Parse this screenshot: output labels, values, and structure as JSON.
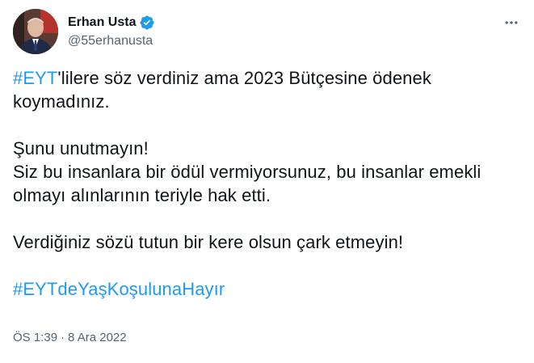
{
  "author": {
    "display_name": "Erhan Usta",
    "handle": "@55erhanusta",
    "verified_icon": "verified-badge-icon",
    "avatar": "profile-photo"
  },
  "menu_icon": "more-horizontal-icon",
  "tweet": {
    "p1": {
      "hashtag": "#EYT",
      "text": "'lilere söz verdiniz ama 2023 Bütçesine ödenek koymadınız."
    },
    "p2": {
      "line1": "Şunu unutmayın!",
      "line2": "Siz bu insanlara bir ödül vermiyorsunuz, bu insanlar emekli olmayı alınlarının teriyle hak etti."
    },
    "p3": "Verdiğiniz sözü tutun bir kere olsun çark etmeyin!",
    "p4_hashtag": "#EYTdeYaşKoşulunaHayır"
  },
  "meta": {
    "time": "ÖS 1:39",
    "separator": "·",
    "date": "8 Ara 2022"
  },
  "colors": {
    "link": "#1d9bf0",
    "text": "#0f1419",
    "secondary": "#536471",
    "verified": "#1d9bf0"
  }
}
